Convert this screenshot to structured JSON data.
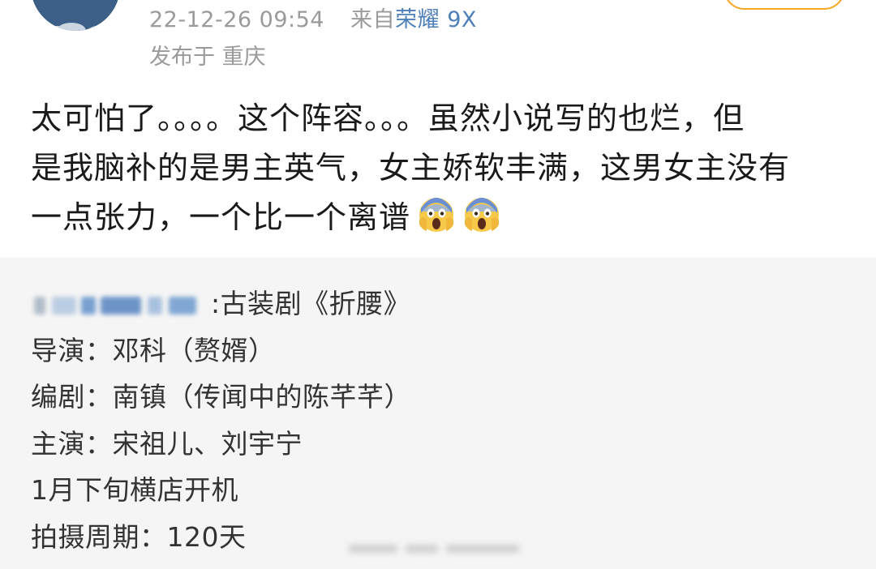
{
  "post": {
    "timestamp": "22-12-26 09:54",
    "source_prefix": "来自",
    "source_device": "荣耀 9X",
    "location": "发布于 重庆",
    "text_lines": [
      "太可怕了。。。。这个阵容。。。虽然小说写的也烂，但",
      "是我脑补的是男主英气，女主娇软丰满，这男女主没有",
      "一点张力，一个比一个离谱"
    ],
    "emojis": [
      "face-screaming-in-fear-icon",
      "face-screaming-in-fear-icon"
    ]
  },
  "repost": {
    "title_suffix": ":古装剧《折腰》",
    "lines": [
      "导演：邓科（赘婿）",
      "编剧：南镇（传闻中的陈芊芊）",
      "主演：宋祖儿、刘宇宁",
      "1月下旬横店开机",
      "拍摄周期：120天"
    ]
  },
  "colors": {
    "link": "#4e7fb8",
    "meta": "#9a9a9a",
    "repost_bg": "#f5f5f5",
    "follow_border": "#f5a623"
  }
}
